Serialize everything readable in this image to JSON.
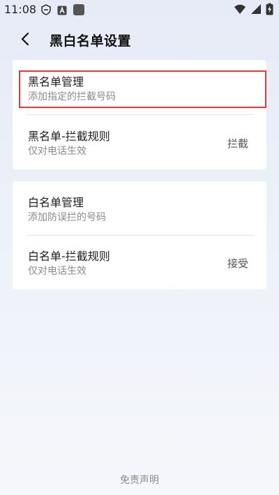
{
  "status_bar": {
    "time": "11:08",
    "left_icons": [
      "vpn-shield-icon",
      "a-box-icon",
      "app-square-icon"
    ],
    "right_icons": [
      "wifi-icon",
      "signal-icon",
      "battery-charging-icon"
    ]
  },
  "header": {
    "title": "黑白名单设置",
    "back_icon": "chevron-left-icon"
  },
  "blacklist_card": {
    "manage": {
      "title": "黑名单管理",
      "subtitle": "添加指定的拦截号码"
    },
    "rule": {
      "title": "黑名单-拦截规则",
      "subtitle": "仅对电话生效",
      "value": "拦截"
    }
  },
  "whitelist_card": {
    "manage": {
      "title": "白名单管理",
      "subtitle": "添加防误拦的号码"
    },
    "rule": {
      "title": "白名单-拦截规则",
      "subtitle": "仅对电话生效",
      "value": "接受"
    }
  },
  "footer": {
    "disclaimer": "免责声明"
  },
  "colors": {
    "highlight": "#e53935",
    "background": "#e9eef8"
  }
}
